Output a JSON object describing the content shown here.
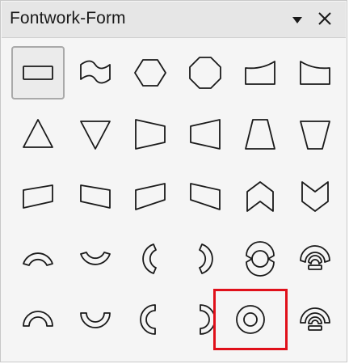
{
  "panel": {
    "title": "Fontwork-Form"
  },
  "icons": {
    "menu": "dropdown-triangle-icon",
    "close": "close-x-icon"
  },
  "colors": {
    "highlight": "#e0101a",
    "selected_bg": "#ebebeb"
  },
  "shapes": [
    {
      "name": "plain-text",
      "selected": true
    },
    {
      "name": "wave"
    },
    {
      "name": "inflate"
    },
    {
      "name": "stop"
    },
    {
      "name": "curve-up"
    },
    {
      "name": "curve-down"
    },
    {
      "name": "triangle-up"
    },
    {
      "name": "triangle-down"
    },
    {
      "name": "fade-right"
    },
    {
      "name": "fade-left"
    },
    {
      "name": "fade-up"
    },
    {
      "name": "fade-down"
    },
    {
      "name": "slant-up"
    },
    {
      "name": "slant-down"
    },
    {
      "name": "fade-up-and-right"
    },
    {
      "name": "fade-up-and-left"
    },
    {
      "name": "chevron-up"
    },
    {
      "name": "chevron-down"
    },
    {
      "name": "arch-up-curve"
    },
    {
      "name": "arch-down-curve"
    },
    {
      "name": "arch-left-curve"
    },
    {
      "name": "arch-right-curve"
    },
    {
      "name": "circle-curve"
    },
    {
      "name": "open-circle-curve"
    },
    {
      "name": "arch-up-pour"
    },
    {
      "name": "arch-down-pour"
    },
    {
      "name": "arch-left-pour"
    },
    {
      "name": "arch-right-pour"
    },
    {
      "name": "circle-pour",
      "highlighted": true
    },
    {
      "name": "open-circle-pour"
    }
  ]
}
